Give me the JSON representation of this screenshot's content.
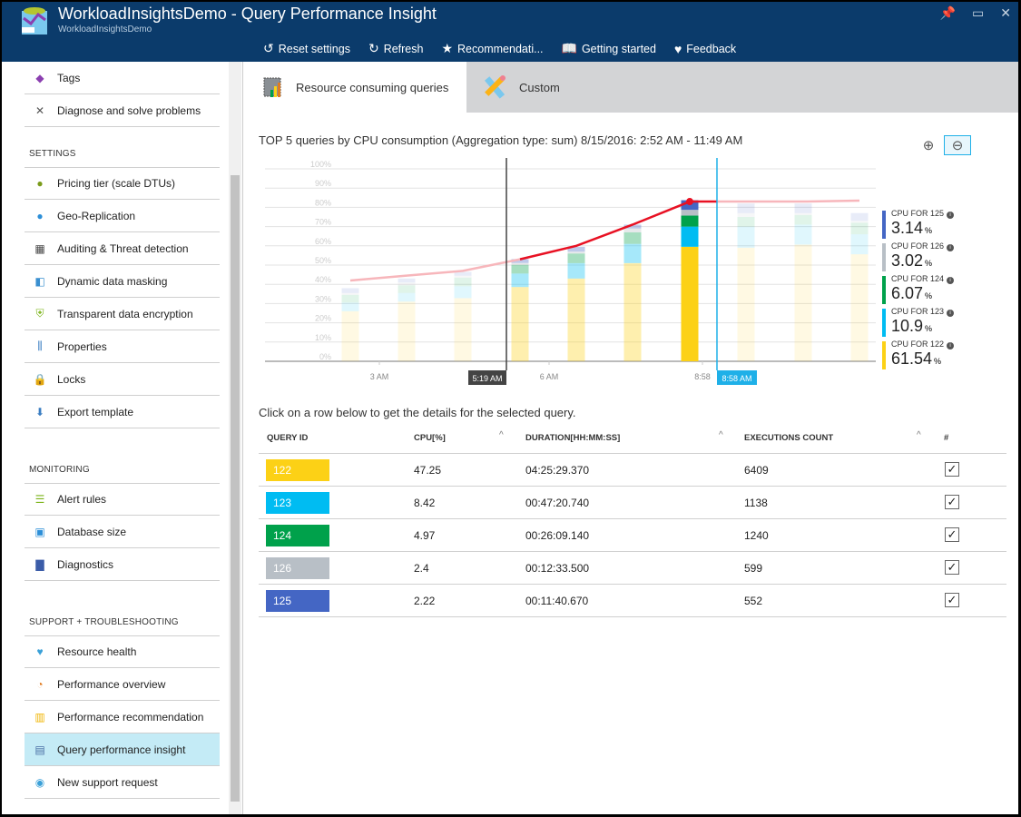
{
  "header": {
    "title": "WorkloadInsightsDemo - Query Performance Insight",
    "subtitle": "WorkloadInsightsDemo",
    "toolbar": [
      {
        "icon": "reset-icon",
        "glyph": "↺",
        "label": "Reset settings"
      },
      {
        "icon": "refresh-icon",
        "glyph": "↻",
        "label": "Refresh"
      },
      {
        "icon": "recommendation-icon",
        "glyph": "★",
        "label": "Recommendati..."
      },
      {
        "icon": "book-icon",
        "glyph": "📖",
        "label": "Getting started"
      },
      {
        "icon": "heart-icon",
        "glyph": "♥",
        "label": "Feedback"
      }
    ]
  },
  "sidebar": {
    "items": [
      {
        "label": "Tags",
        "icon": "tag-icon",
        "glyph": "◆",
        "color": "#8b3fb0",
        "top": 0
      },
      {
        "label": "Diagnose and solve problems",
        "icon": "tools-icon",
        "glyph": "✕",
        "color": "#555",
        "top": 36
      }
    ],
    "sections": [
      {
        "title": "SETTINGS",
        "items": [
          {
            "label": "Pricing tier (scale DTUs)",
            "icon": "pricing-icon",
            "glyph": "●",
            "color": "#7a9b1a"
          },
          {
            "label": "Geo-Replication",
            "icon": "globe-icon",
            "glyph": "●",
            "color": "#2d8fd8"
          },
          {
            "label": "Auditing & Threat detection",
            "icon": "audit-icon",
            "glyph": "▦",
            "color": "#444"
          },
          {
            "label": "Dynamic data masking",
            "icon": "mask-icon",
            "glyph": "◧",
            "color": "#3a8fd0"
          },
          {
            "label": "Transparent data encryption",
            "icon": "shield-icon",
            "glyph": "⛨",
            "color": "#7ab317"
          },
          {
            "label": "Properties",
            "icon": "properties-icon",
            "glyph": "⫼",
            "color": "#3b7ec2"
          },
          {
            "label": "Locks",
            "icon": "lock-icon",
            "glyph": "🔒",
            "color": "#222"
          },
          {
            "label": "Export template",
            "icon": "export-icon",
            "glyph": "⬇",
            "color": "#3b7ec2"
          }
        ]
      },
      {
        "title": "MONITORING",
        "items": [
          {
            "label": "Alert rules",
            "icon": "alert-rules-icon",
            "glyph": "☰",
            "color": "#7ab317"
          },
          {
            "label": "Database size",
            "icon": "database-icon",
            "glyph": "▣",
            "color": "#2d8fd8"
          },
          {
            "label": "Diagnostics",
            "icon": "diagnostics-icon",
            "glyph": "▇",
            "color": "#3b5ca8"
          }
        ]
      },
      {
        "title": "SUPPORT + TROUBLESHOOTING",
        "items": [
          {
            "label": "Resource health",
            "icon": "heart-pulse-icon",
            "glyph": "♥",
            "color": "#3aa0d8"
          },
          {
            "label": "Performance overview",
            "icon": "gauge-icon",
            "glyph": "◔",
            "color": "#e07b20"
          },
          {
            "label": "Performance recommendation",
            "icon": "recommendation-icon",
            "glyph": "▥",
            "color": "#f0b400"
          },
          {
            "label": "Query performance insight",
            "icon": "query-insight-icon",
            "glyph": "▤",
            "color": "#4a6fa5",
            "selected": true
          },
          {
            "label": "New support request",
            "icon": "support-icon",
            "glyph": "◉",
            "color": "#3aa0d8"
          }
        ]
      }
    ]
  },
  "tabs": [
    {
      "label": "Resource consuming queries",
      "icon": "resource-queries-icon",
      "active": true
    },
    {
      "label": "Custom",
      "icon": "ruler-pencil-icon",
      "active": false
    }
  ],
  "chart_title": "TOP 5 queries by CPU consumption (Aggregation type: sum) 8/15/2016: 2:52 AM - 11:49 AM",
  "zoom": {
    "in": "zoom-in-icon",
    "out": "zoom-out-icon"
  },
  "chart_data": {
    "type": "bar",
    "stacked": true,
    "ylim": [
      0,
      100
    ],
    "yticks": [
      "0%",
      "10%",
      "20%",
      "30%",
      "40%",
      "50%",
      "60%",
      "70%",
      "80%",
      "90%",
      "100%"
    ],
    "xticks": [
      "3 AM",
      "6 AM",
      "8:58"
    ],
    "selection": {
      "start": "5:19 AM",
      "end": "8:58 AM"
    },
    "series": [
      {
        "name": "122",
        "color": "#fcd116",
        "values": [
          26,
          31,
          32.8,
          38.6,
          43,
          51,
          59.5,
          59,
          60.6,
          55.6
        ]
      },
      {
        "name": "123",
        "color": "#00bcf2",
        "values": [
          4.5,
          4.5,
          6.2,
          7,
          8,
          10,
          10.5,
          11,
          10.4,
          10.4
        ]
      },
      {
        "name": "124",
        "color": "#00a14b",
        "values": [
          4,
          4,
          4.5,
          4.5,
          5,
          6,
          5.7,
          5,
          5,
          6
        ]
      },
      {
        "name": "126",
        "color": "#b8bfc6",
        "values": [
          1,
          1.5,
          1,
          1,
          1,
          2,
          3,
          2,
          1,
          1
        ]
      },
      {
        "name": "125",
        "color": "#4466c4",
        "values": [
          2.5,
          2,
          2,
          2,
          2.5,
          2,
          5,
          5,
          5,
          4
        ]
      }
    ],
    "line": {
      "color": "#e81123",
      "values": [
        42,
        44.5,
        47,
        53,
        60,
        71,
        83,
        83,
        83,
        83.5
      ]
    }
  },
  "legend": [
    {
      "label": "CPU FOR 125",
      "value": "3.14",
      "color": "#4466c4"
    },
    {
      "label": "CPU FOR 126",
      "value": "3.02",
      "color": "#b8bfc6"
    },
    {
      "label": "CPU FOR 124",
      "value": "6.07",
      "color": "#00a14b"
    },
    {
      "label": "CPU FOR 123",
      "value": "10.9",
      "color": "#00bcf2"
    },
    {
      "label": "CPU FOR 122",
      "value": "61.54",
      "color": "#fcd116"
    }
  ],
  "hint": "Click on a row below to get the details for the selected query.",
  "table": {
    "headers": [
      "QUERY ID",
      "CPU[%]",
      "DURATION[HH:MM:SS]",
      "EXECUTIONS COUNT",
      "#"
    ],
    "rows": [
      {
        "id": "122",
        "cpu": "47.25",
        "duration": "04:25:29.370",
        "executions": "6409",
        "color": "#fcd116",
        "checked": true
      },
      {
        "id": "123",
        "cpu": "8.42",
        "duration": "00:47:20.740",
        "executions": "1138",
        "color": "#00bcf2",
        "checked": true
      },
      {
        "id": "124",
        "cpu": "4.97",
        "duration": "00:26:09.140",
        "executions": "1240",
        "color": "#00a14b",
        "checked": true
      },
      {
        "id": "126",
        "cpu": "2.4",
        "duration": "00:12:33.500",
        "executions": "599",
        "color": "#b8bfc6",
        "checked": true
      },
      {
        "id": "125",
        "cpu": "2.22",
        "duration": "00:11:40.670",
        "executions": "552",
        "color": "#4466c4",
        "checked": true
      }
    ]
  }
}
